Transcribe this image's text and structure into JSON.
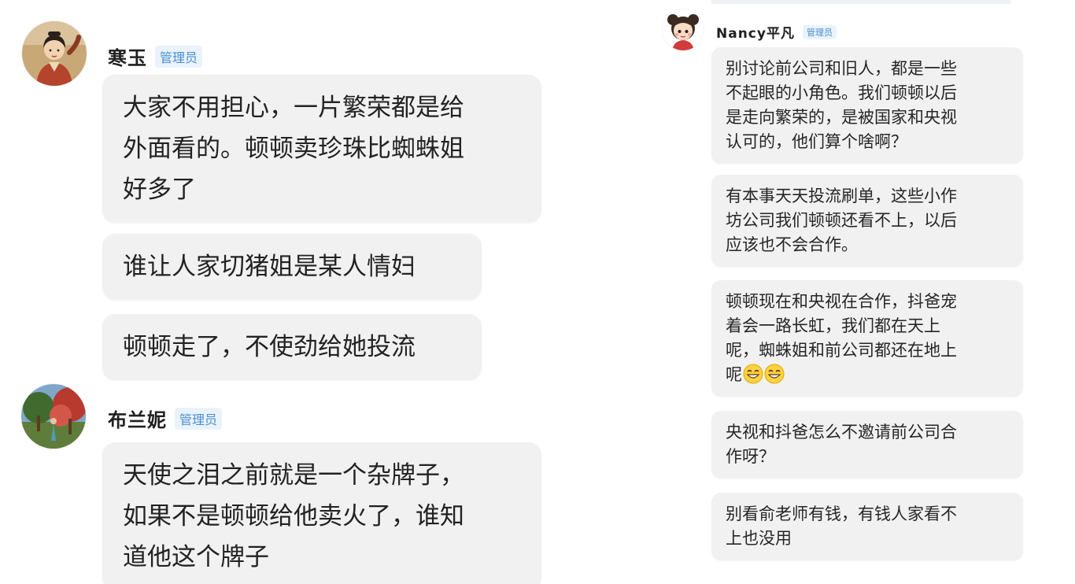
{
  "left_chat": {
    "groups": [
      {
        "sender": "寒玉",
        "badge": "管理员",
        "avatar_icon": "woman-in-traditional-dress-avatar-icon",
        "messages": [
          "大家不用担心，一片繁荣都是给\n外面看的。顿顿卖珍珠比蜘蛛姐\n好多了",
          "谁让人家切猪姐是某人情妇",
          "顿顿走了，不使劲给她投流"
        ]
      },
      {
        "sender": "布兰妮",
        "badge": "管理员",
        "avatar_icon": "outdoor-landscape-avatar-icon",
        "messages": [
          "天使之泪之前就是一个杂牌子，\n如果不是顿顿给他卖火了，谁知\n道他这个牌子"
        ]
      }
    ]
  },
  "right_chat": {
    "sender": "Nancy平凡",
    "badge": "管理员",
    "avatar_icon": "cartoon-girl-avatar-icon",
    "messages": [
      "别讨论前公司和旧人，都是一些\n不起眼的小角色。我们顿顿以后\n是走向繁荣的，是被国家和央视\n认可的，他们算个啥啊？",
      "有本事天天投流刷单，这些小作\n坊公司我们顿顿还看不上，以后\n应该也不会合作。",
      "顿顿现在和央视在合作，抖爸宠\n着会一路长虹，我们都在天上\n呢，蜘蛛姐和前公司都还在地上\n呢",
      "央视和抖爸怎么不邀请前公司合\n作呀？",
      "别看俞老师有钱，有钱人家看不\n上也没用"
    ],
    "emoji_icon": "grinning-face-emoji-icon"
  },
  "colors": {
    "bubble": "#f1f1f1",
    "badge_bg": "#eaf3fb",
    "badge_text": "#4a8fd1"
  }
}
